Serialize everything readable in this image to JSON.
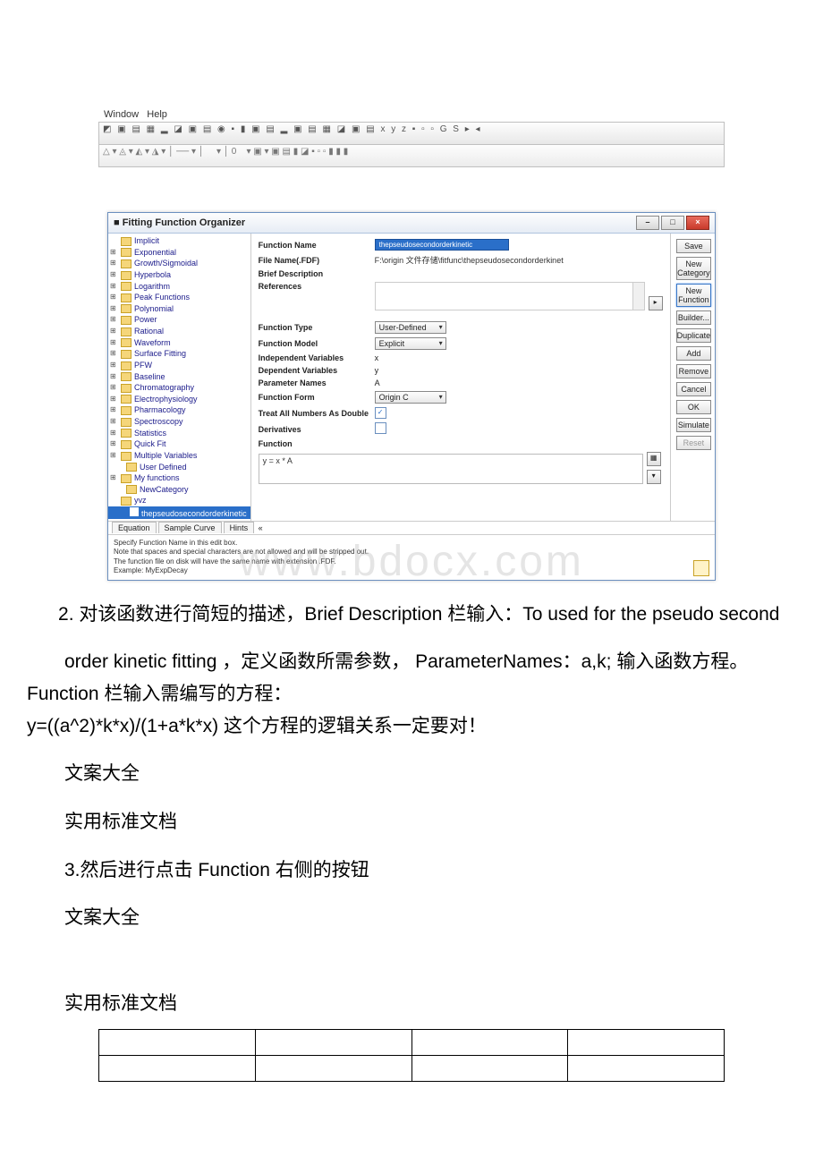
{
  "menubar": {
    "window": "Window",
    "help": "Help"
  },
  "dialog": {
    "title": "Fitting Function Organizer",
    "form": {
      "function_name_label": "Function Name",
      "function_name_value": "thepseudosecondorderkinetic",
      "file_name_label": "File Name(.FDF)",
      "file_name_value": "F:\\origin 文件存储\\fitfunc\\thepseudosecondorderkinet",
      "brief_desc_label": "Brief Description",
      "references_label": "References",
      "function_type_label": "Function Type",
      "function_type_value": "User-Defined",
      "function_model_label": "Function Model",
      "function_model_value": "Explicit",
      "independent_label": "Independent Variables",
      "independent_value": "x",
      "dependent_label": "Dependent Variables",
      "dependent_value": "y",
      "param_names_label": "Parameter Names",
      "param_names_value": "A",
      "function_form_label": "Function Form",
      "function_form_value": "Origin C",
      "treat_double_label": "Treat All Numbers As Double",
      "derivatives_label": "Derivatives",
      "function_label": "Function",
      "function_body": "y = x * A"
    },
    "tabs": {
      "equation": "Equation",
      "sample": "Sample Curve",
      "hints": "Hints"
    },
    "hint_lines": {
      "l1": "Specify Function Name in this edit box.",
      "l2": "Note that spaces and special characters are not allowed and will be stripped out.",
      "l3": "The function file on disk will have the same name with extension .FDF.",
      "l4": "Example: MyExpDecay"
    },
    "tree": {
      "items": [
        "Implicit",
        "Exponential",
        "Growth/Sigmoidal",
        "Hyperbola",
        "Logarithm",
        "Peak Functions",
        "Polynomial",
        "Power",
        "Rational",
        "Waveform",
        "Surface Fitting",
        "PFW",
        "Baseline",
        "Chromatography",
        "Electrophysiology",
        "Pharmacology",
        "Spectroscopy",
        "Statistics",
        "Quick Fit",
        "Multiple Variables",
        "User Defined",
        "My functions",
        "NewCategory",
        "yvz"
      ],
      "selected": "thepseudosecondorderkinetic"
    },
    "buttons": {
      "save": "Save",
      "new_category": "New Category",
      "new_function": "New Function",
      "builder": "Builder...",
      "duplicate": "Duplicate",
      "add": "Add",
      "remove": "Remove",
      "cancel": "Cancel",
      "ok": "OK",
      "simulate": "Simulate",
      "reset": "Reset"
    }
  },
  "watermark": "www.bdocx.com",
  "doc": {
    "p2a": "2. 对该函数进行简短的描述，Brief Description 栏输入：To used for the pseudo second",
    "p2b": "order kinetic fitting ，定义函数所需参数， ParameterNames：a,k; 输入函数方程。 Function 栏输入需编写的方程：",
    "p2c": "y=((a^2)*k*x)/(1+a*k*x) 这个方程的逻辑关系一定要对！",
    "wa": "文案大全",
    "sy": "实用标准文档",
    "p3": "3.然后进行点击 Function 右侧的按钮"
  }
}
